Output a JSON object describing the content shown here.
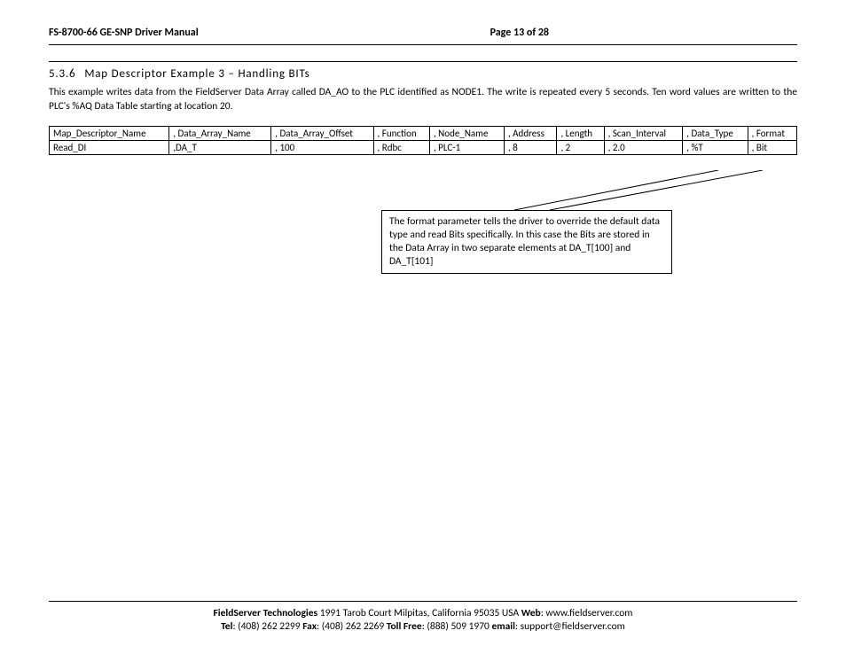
{
  "header": {
    "manual_title": "FS-8700-66 GE-SNP Driver Manual",
    "page_info": "Page 13 of 28"
  },
  "section": {
    "number": "5.3.6",
    "title": "Map Descriptor Example 3 – Handling BITs",
    "body": "This example writes data from the FieldServer Data Array called DA_AO to the PLC identified as NODE1. The write is repeated every 5 seconds. Ten word values are written to the PLC's %AQ Data Table starting at location 20."
  },
  "table": {
    "headers": [
      "Map_Descriptor_Name",
      ", Data_Array_Name",
      ", Data_Array_Offset",
      ", Function",
      ", Node_Name",
      ", Address",
      ", Length",
      ", Scan_Interval",
      ", Data_Type",
      ", Format"
    ],
    "row": [
      "Read_DI",
      ",DA_T",
      ", 100",
      ", Rdbc",
      ", PLC-1",
      ", 8",
      ", 2",
      ", 2.0",
      ", %T",
      ", Bit"
    ]
  },
  "callout": "The format parameter tells the driver to override the default data type and read Bits specifically.  In this case the Bits are stored in the Data Array in two separate elements at DA_T[100] and DA_T[101]",
  "footer": {
    "company": "FieldServer Technologies",
    "address": " 1991 Tarob Court Milpitas, California 95035 USA   ",
    "web_label": "Web",
    "web": ": www.fieldserver.com",
    "tel_label": "Tel",
    "tel": ": (408) 262 2299   ",
    "fax_label": "Fax",
    "fax": ": (408) 262 2269   ",
    "toll_label": "Toll Free",
    "toll": ": (888) 509 1970   ",
    "email_label": "email",
    "email": ": support@fieldserver.com"
  }
}
